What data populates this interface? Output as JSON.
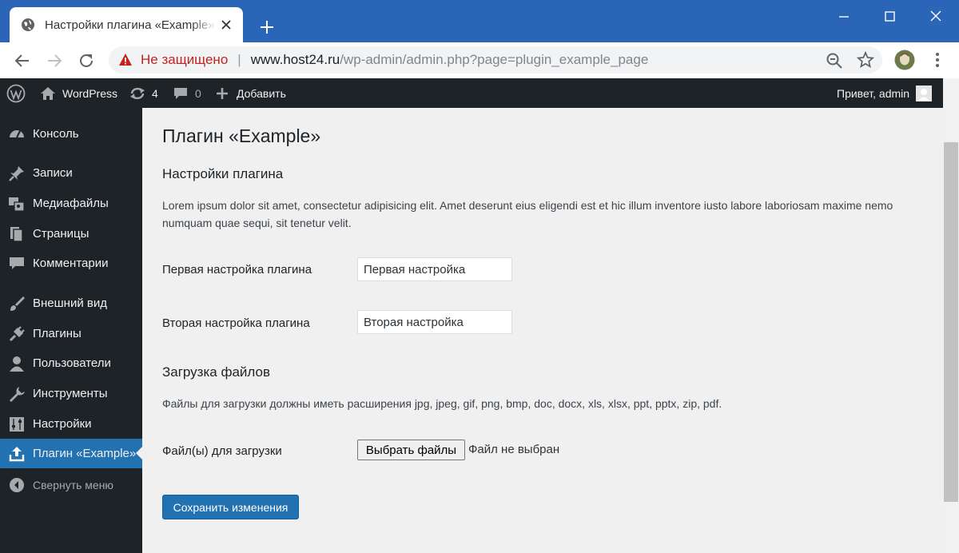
{
  "browser": {
    "tab_title": "Настройки плагина «Example» ‹",
    "insecure_label": "Не защищено",
    "url_host": "www.host24.ru",
    "url_path": "/wp-admin/admin.php?page=plugin_example_page"
  },
  "admin_bar": {
    "site_name": "WordPress",
    "updates_count": "4",
    "comments_count": "0",
    "add_new_label": "Добавить",
    "greeting": "Привет, admin"
  },
  "sidebar": {
    "items": [
      {
        "label": "Консоль",
        "icon": "dashboard-icon"
      },
      {
        "label": "Записи",
        "icon": "pin-icon"
      },
      {
        "label": "Медиафайлы",
        "icon": "media-icon"
      },
      {
        "label": "Страницы",
        "icon": "pages-icon"
      },
      {
        "label": "Комментарии",
        "icon": "comments-icon"
      },
      {
        "label": "Внешний вид",
        "icon": "brush-icon"
      },
      {
        "label": "Плагины",
        "icon": "plugin-icon"
      },
      {
        "label": "Пользователи",
        "icon": "user-icon"
      },
      {
        "label": "Инструменты",
        "icon": "wrench-icon"
      },
      {
        "label": "Настройки",
        "icon": "settings-icon"
      },
      {
        "label": "Плагин «Example»",
        "icon": "upload-icon"
      }
    ],
    "collapse_label": "Свернуть меню",
    "active_color": "#2271b1"
  },
  "page": {
    "title": "Плагин «Example»",
    "section1_title": "Настройки плагина",
    "section1_desc": "Lorem ipsum dolor sit amet, consectetur adipisicing elit. Amet deserunt eius eligendi est et hic illum inventore iusto labore laboriosam maxime nemo numquam quae sequi, sit tenetur velit.",
    "field1_label": "Первая настройка плагина",
    "field1_value": "Первая настройка",
    "field2_label": "Вторая настройка плагина",
    "field2_value": "Вторая настройка",
    "section2_title": "Загрузка файлов",
    "section2_desc": "Файлы для загрузки должны иметь расширения jpg, jpeg, gif, png, bmp, doc, docx, xls, xlsx, ppt, pptx, zip, pdf.",
    "file_label": "Файл(ы) для загрузки",
    "file_button": "Выбрать файлы",
    "file_status": "Файл не выбран",
    "save_button": "Сохранить изменения"
  }
}
